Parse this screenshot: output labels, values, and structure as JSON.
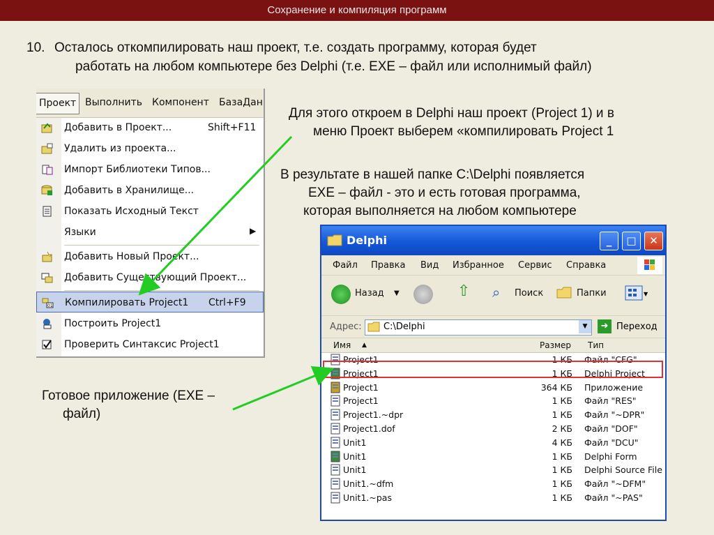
{
  "header": {
    "title": "Сохранение и компиляция программ"
  },
  "step": {
    "number": "10.",
    "line1": "Осталось откомпилировать наш проект, т.е. создать программу, которая будет",
    "line2": "работать на любом компьютере без Delphi (т.е. EXE – файл или исполнимый файл)"
  },
  "para1": {
    "line1": "Для этого откроем в Delphi наш проект (Project 1) и в",
    "line2": "меню Проект выберем «компилировать Project 1"
  },
  "para2": {
    "line1": "В результате в нашей папке C:\\Delphi появляется",
    "line2": "EXE – файл  - это и есть готовая программа,",
    "line3": "которая выполняется на любом компьютере"
  },
  "ready": {
    "line1": "Готовое приложение (EXE –",
    "line2": "файл)"
  },
  "delphi_menu": {
    "menubar": [
      "Проект",
      "Выполнить",
      "Компонент",
      "БазаДан"
    ],
    "items": [
      {
        "label": "Добавить в Проект...",
        "shortcut": "Shift+F11",
        "icon": "add-to-project-icon"
      },
      {
        "label": "Удалить из проекта...",
        "shortcut": "",
        "icon": "remove-from-project-icon"
      },
      {
        "label": "Импорт Библиотеки Типов...",
        "shortcut": "",
        "icon": "import-type-library-icon"
      },
      {
        "label": "Добавить в Хранилище...",
        "shortcut": "",
        "icon": "add-to-repository-icon"
      },
      {
        "label": "Показать Исходный Текст",
        "shortcut": "",
        "icon": "view-source-icon"
      },
      {
        "label": "Языки",
        "shortcut": "",
        "icon": ""
      },
      {
        "label": "Добавить Новый Проект...",
        "shortcut": "",
        "icon": "add-new-project-icon"
      },
      {
        "label": "Добавить Существующий Проект...",
        "shortcut": "",
        "icon": "add-existing-project-icon"
      },
      {
        "label": "Компилировать Project1",
        "shortcut": "Ctrl+F9",
        "icon": "compile-icon"
      },
      {
        "label": "Построить Project1",
        "shortcut": "",
        "icon": "build-icon"
      },
      {
        "label": "Проверить Синтаксис Project1",
        "shortcut": "",
        "icon": "syntax-check-icon"
      }
    ]
  },
  "explorer": {
    "title": "Delphi",
    "menu": [
      "Файл",
      "Правка",
      "Вид",
      "Избранное",
      "Сервис",
      "Справка"
    ],
    "toolbar": {
      "back": "Назад",
      "search": "Поиск",
      "folders": "Папки"
    },
    "address_label": "Адрес:",
    "address_value": "C:\\Delphi",
    "go_label": "Переход",
    "columns": {
      "name": "Имя",
      "size": "Размер",
      "type": "Тип"
    },
    "files": [
      {
        "name": "Project1",
        "size": "1 КБ",
        "type": "Файл \"CFG\"",
        "icon": "cfg-file-icon"
      },
      {
        "name": "Project1",
        "size": "1 КБ",
        "type": "Delphi Project",
        "icon": "delphi-project-icon"
      },
      {
        "name": "Project1",
        "size": "364 КБ",
        "type": "Приложение",
        "icon": "application-exe-icon"
      },
      {
        "name": "Project1",
        "size": "1 КБ",
        "type": "Файл \"RES\"",
        "icon": "res-file-icon"
      },
      {
        "name": "Project1.~dpr",
        "size": "1 КБ",
        "type": "Файл \"~DPR\"",
        "icon": "dpr-backup-file-icon"
      },
      {
        "name": "Project1.dof",
        "size": "2 КБ",
        "type": "Файл \"DOF\"",
        "icon": "dof-file-icon"
      },
      {
        "name": "Unit1",
        "size": "4 КБ",
        "type": "Файл \"DCU\"",
        "icon": "dcu-file-icon"
      },
      {
        "name": "Unit1",
        "size": "1 КБ",
        "type": "Delphi Form",
        "icon": "delphi-form-icon"
      },
      {
        "name": "Unit1",
        "size": "1 КБ",
        "type": "Delphi Source File",
        "icon": "delphi-source-icon"
      },
      {
        "name": "Unit1.~dfm",
        "size": "1 КБ",
        "type": "Файл \"~DFM\"",
        "icon": "dfm-backup-file-icon"
      },
      {
        "name": "Unit1.~pas",
        "size": "1 КБ",
        "type": "Файл \"~PAS\"",
        "icon": "pas-backup-file-icon"
      }
    ]
  },
  "colors": {
    "header_bg": "#7a1212",
    "background": "#efede0",
    "arrow": "#22cc22",
    "highlight": "#e03030"
  }
}
